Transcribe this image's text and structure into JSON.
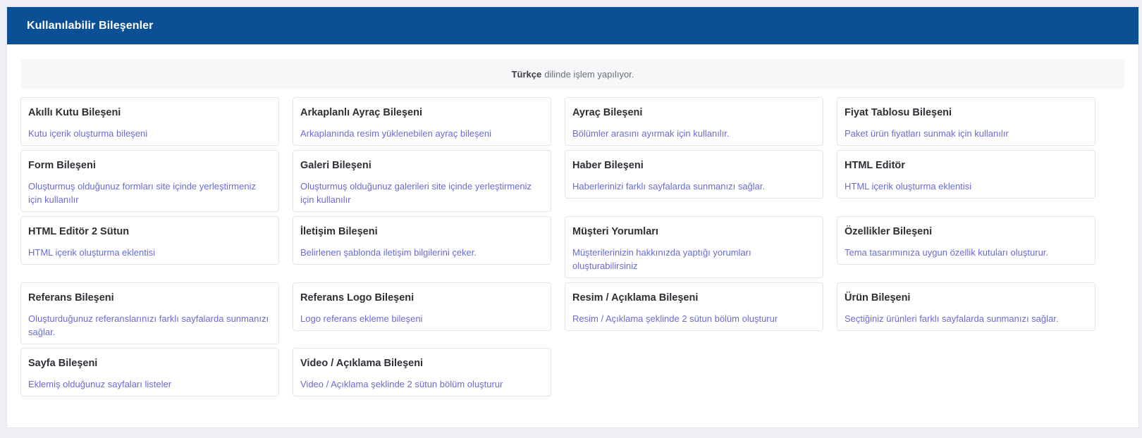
{
  "panel": {
    "title": "Kullanılabilir Bileşenler"
  },
  "language_notice": {
    "language": "Türkçe",
    "text": "dilinde işlem yapılıyor."
  },
  "components": [
    {
      "title": "Akıllı Kutu Bileşeni",
      "description": "Kutu içerik oluşturma bileşeni"
    },
    {
      "title": "Arkaplanlı Ayraç Bileşeni",
      "description": "Arkaplanında resim yüklenebilen ayraç bileşeni"
    },
    {
      "title": "Ayraç Bileşeni",
      "description": "Bölümler arasını ayırmak için kullanılır."
    },
    {
      "title": "Fiyat Tablosu Bileşeni",
      "description": "Paket ürün fiyatları sunmak için kullanılır"
    },
    {
      "title": "Form Bileşeni",
      "description": "Oluşturmuş olduğunuz formları site içinde yerleştirmeniz için kullanılır"
    },
    {
      "title": "Galeri Bileşeni",
      "description": "Oluşturmuş olduğunuz galerileri site içinde yerleştirmeniz için kullanılır"
    },
    {
      "title": "Haber Bileşeni",
      "description": "Haberlerinizi farklı sayfalarda sunmanızı sağlar."
    },
    {
      "title": "HTML Editör",
      "description": "HTML içerik oluşturma eklentisi"
    },
    {
      "title": "HTML Editör 2 Sütun",
      "description": "HTML içerik oluşturma eklentisi"
    },
    {
      "title": "İletişim Bileşeni",
      "description": "Belirlenen şablonda iletişim bilgilerini çeker."
    },
    {
      "title": "Müşteri Yorumları",
      "description": "Müşterilerinizin hakkınızda yaptığı yorumları oluşturabilirsiniz"
    },
    {
      "title": "Özellikler Bileşeni",
      "description": "Tema tasarımınıza uygun özellik kutuları oluşturur."
    },
    {
      "title": "Referans Bileşeni",
      "description": "Oluşturduğunuz referanslarınızı farklı sayfalarda sunmanızı sağlar."
    },
    {
      "title": "Referans Logo Bileşeni",
      "description": "Logo referans ekleme bileşeni"
    },
    {
      "title": "Resim / Açıklama Bileşeni",
      "description": "Resim / Açıklama şeklinde 2 sütun bölüm oluşturur"
    },
    {
      "title": "Ürün Bileşeni",
      "description": "Seçtiğiniz ürünleri farklı sayfalarda sunmanızı sağlar."
    },
    {
      "title": "Sayfa Bileşeni",
      "description": "Eklemiş olduğunuz sayfaları listeler"
    },
    {
      "title": "Video / Açıklama Bileşeni",
      "description": "Video / Açıklama şeklinde 2 sütun bölüm oluşturur"
    }
  ]
}
